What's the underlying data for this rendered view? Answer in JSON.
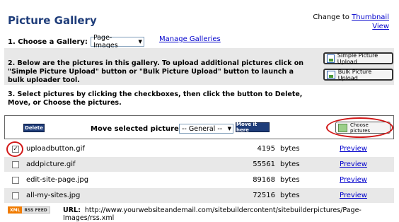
{
  "header": {
    "title": "Picture Gallery",
    "change_to_text": "Change to",
    "thumbnail_view_link": "Thumbnail View"
  },
  "step1": {
    "label": "1. Choose a Gallery:",
    "gallery_select_value": "Page-Images",
    "manage_link": "Manage Galleries"
  },
  "step2": {
    "text": "2. Below are the pictures in this gallery. To upload additional pictures click on \"Simple Picture Upload\" button or \"Bulk Picture Upload\" button to launch a bulk uploader tool.",
    "simple_upload_label": "Simple Picture Upload",
    "bulk_upload_label": "Bulk Picture Upload"
  },
  "step3": {
    "text": "3. Select pictures by clicking the checkboxes, then click the button to Delete, Move, or Choose the pictures."
  },
  "actions": {
    "delete_label": "Delete",
    "move_label": "Move selected pictures to:",
    "move_select_value": "-- General --",
    "move_button_label": "Move it here",
    "choose_label": "Choose pictures"
  },
  "files": [
    {
      "name": "uploadbutton.gif",
      "size": "4195",
      "unit": "bytes",
      "preview": "Preview",
      "checked": true
    },
    {
      "name": "addpicture.gif",
      "size": "55561",
      "unit": "bytes",
      "preview": "Preview",
      "checked": false
    },
    {
      "name": "edit-site-page.jpg",
      "size": "89168",
      "unit": "bytes",
      "preview": "Preview",
      "checked": false
    },
    {
      "name": "all-my-sites.jpg",
      "size": "72516",
      "unit": "bytes",
      "preview": "Preview",
      "checked": false
    }
  ],
  "footer": {
    "rss_xml": "XML",
    "rss_feed": "RSS FEED",
    "url_label": "URL:",
    "url_value": "http://www.yourwebsiteandemail.com/sitebuildercontent/sitebuilderpictures/Page-Images/rss.xml"
  },
  "colors": {
    "title": "#1f3d7a",
    "link": "#0000cc",
    "button_navy": "#1f3d7a",
    "highlight_ring": "#d21818",
    "row_alt": "#e8e8e8"
  }
}
